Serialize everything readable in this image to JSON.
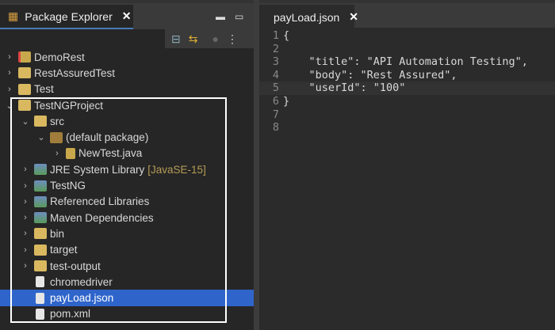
{
  "left_panel": {
    "tab_title": "Package Explorer",
    "close": "✕",
    "minimize": "▬",
    "maximize": "▭",
    "toolbar": {
      "collapse": "⊟",
      "link": "⇆",
      "filter": "●",
      "menu": "⋮"
    },
    "tree": [
      {
        "label": "DemoRest",
        "arrow": "›",
        "icon": "project-error-icon",
        "depth": 0
      },
      {
        "label": "RestAssuredTest",
        "arrow": "›",
        "icon": "project-warning-icon",
        "depth": 0
      },
      {
        "label": "Test",
        "arrow": "›",
        "icon": "project-warning-icon",
        "depth": 0
      },
      {
        "label": "TestNGProject",
        "arrow": "⌄",
        "icon": "project-warning-icon",
        "depth": 0
      },
      {
        "label": "src",
        "arrow": "⌄",
        "icon": "source-folder-icon",
        "depth": 1
      },
      {
        "label": "(default package)",
        "arrow": "⌄",
        "icon": "package-icon",
        "depth": 2
      },
      {
        "label": "NewTest.java",
        "arrow": "›",
        "icon": "java-file-icon",
        "depth": 3
      },
      {
        "label": "JRE System Library",
        "decoration": "[JavaSE-15]",
        "arrow": "›",
        "icon": "library-icon",
        "depth": 1
      },
      {
        "label": "TestNG",
        "arrow": "›",
        "icon": "library-icon",
        "depth": 1
      },
      {
        "label": "Referenced Libraries",
        "arrow": "›",
        "icon": "library-icon",
        "depth": 1
      },
      {
        "label": "Maven Dependencies",
        "arrow": "›",
        "icon": "library-icon",
        "depth": 1
      },
      {
        "label": "bin",
        "arrow": "›",
        "icon": "folder-icon",
        "depth": 1
      },
      {
        "label": "target",
        "arrow": "›",
        "icon": "folder-icon",
        "depth": 1
      },
      {
        "label": "test-output",
        "arrow": "›",
        "icon": "folder-icon",
        "depth": 1
      },
      {
        "label": "chromedriver",
        "arrow": "",
        "icon": "file-icon",
        "depth": 1
      },
      {
        "label": "payLoad.json",
        "arrow": "",
        "icon": "file-icon",
        "depth": 1,
        "selected": true
      },
      {
        "label": "pom.xml",
        "arrow": "",
        "icon": "file-icon",
        "depth": 1
      }
    ]
  },
  "editor": {
    "tab_title": "payLoad.json",
    "close": "✕",
    "lines": [
      {
        "n": "1",
        "text": "{"
      },
      {
        "n": "2",
        "text": ""
      },
      {
        "n": "3",
        "text": "    \"title\": \"API Automation Testing\","
      },
      {
        "n": "4",
        "text": "    \"body\": \"Rest Assured\","
      },
      {
        "n": "5",
        "text": "    \"userId\": \"100\""
      },
      {
        "n": "6",
        "text": "}"
      },
      {
        "n": "7",
        "text": ""
      },
      {
        "n": "8",
        "text": ""
      }
    ],
    "current_line": 5
  },
  "colors": {
    "selection": "#2f65ca",
    "tab_underline": "#4a7ab8"
  }
}
